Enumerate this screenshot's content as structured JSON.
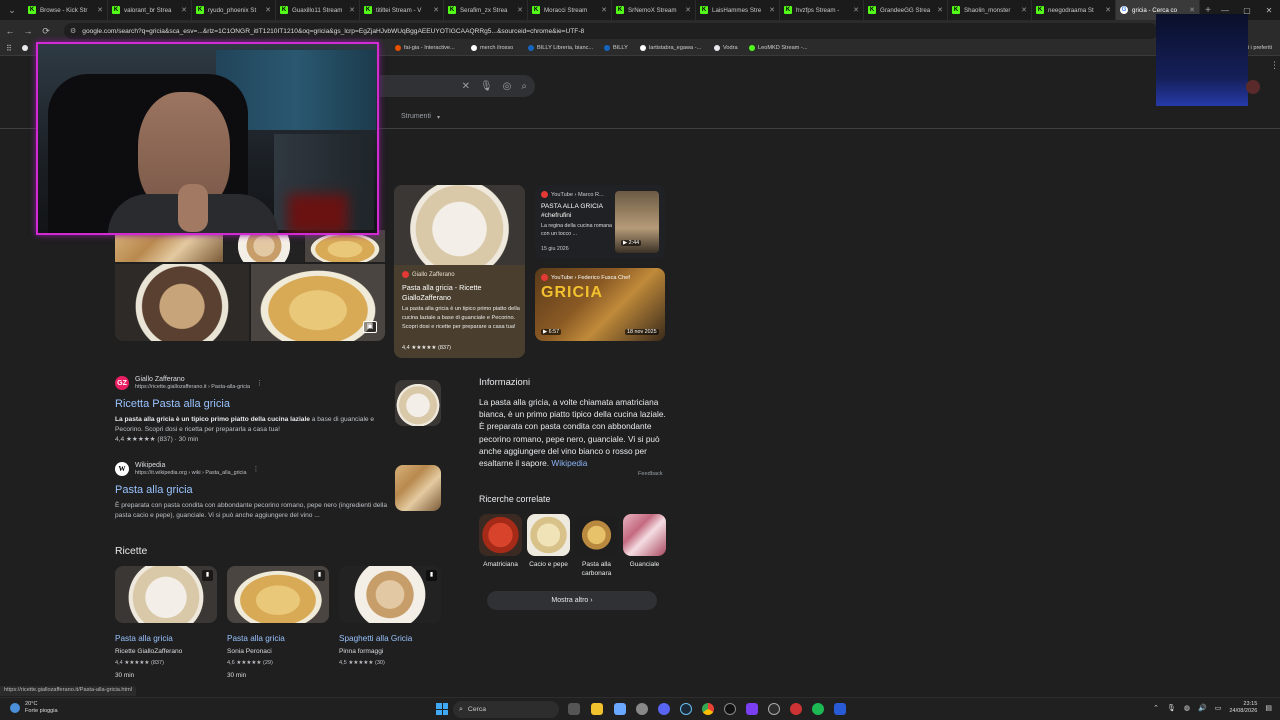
{
  "browser": {
    "tabs": [
      {
        "label": "Browse - Kick Str",
        "active": false
      },
      {
        "label": "valorant_br Strea",
        "active": false
      },
      {
        "label": "ryudo_phoenix St",
        "active": false
      },
      {
        "label": "Guaxillo11 Stream",
        "active": false
      },
      {
        "label": "titiltei Stream - V",
        "active": false
      },
      {
        "label": "Serafim_zx Strea",
        "active": false
      },
      {
        "label": "Moracci Stream",
        "active": false
      },
      {
        "label": "SrNemoX Stream",
        "active": false
      },
      {
        "label": "LaisHammes Stre",
        "active": false
      },
      {
        "label": "hvzfps Stream -",
        "active": false
      },
      {
        "label": "GrandeeGG Strea",
        "active": false
      },
      {
        "label": "Shaolin_monster",
        "active": false
      },
      {
        "label": "neegodraama St",
        "active": false
      },
      {
        "label": "gricia - Cerca co",
        "active": true
      }
    ],
    "url": "google.com/search?q=gricia&sca_esv=...&rlz=1C1ONGR_itIT1210IT1210&oq=gricia&gs_lcrp=EgZjaHJvbWUqBggAEEUYOTIGCAAQRRg5...&sourceid=chrome&ie=UTF-8",
    "bookmarks": [
      {
        "label": "",
        "color": "#e8eaed"
      },
      {
        "label": "fai-gia - Interactive...",
        "color": "#e65100"
      },
      {
        "label": "merch ilrosso",
        "color": "#ffffff"
      },
      {
        "label": "BILLY Libreria, bianc...",
        "color": "#1565c0"
      },
      {
        "label": "BILLY",
        "color": "#1565c0"
      },
      {
        "label": "lartistabra_egawa -...",
        "color": "#ffffff"
      },
      {
        "label": "Vodra",
        "color": "#e8eaed"
      },
      {
        "label": "LeoMKD Stream -...",
        "color": "#53fc18"
      }
    ],
    "other_bookmarks": "Tutti i preferiti"
  },
  "search": {
    "tools_label": "Strumenti"
  },
  "images": {
    "featured": {
      "source": "Giallo Zafferano",
      "title": "Pasta alla gricia - Ricette GialloZafferano",
      "description": "La pasta alla gricia è un tipico primo piatto della cucina laziale a base di guanciale e Pecorino. Scopri dosi e ricette per preparare a casa tua!",
      "rating": "4,4 ★★★★★ (837)"
    },
    "yt1": {
      "source": "YouTube › Marco R...",
      "title": "PASTA ALLA GRICIA #chefrufini",
      "description": "La regina della cucina romana con un tocco ...",
      "date": "15 giu 2026",
      "duration": "▶ 2:44"
    },
    "yt2": {
      "source": "YouTube › Federico Fusca Chef",
      "big_text": "GRICIA",
      "duration": "▶ 6:57",
      "date": "18 nov 2025"
    }
  },
  "results": [
    {
      "site": "Giallo Zafferano",
      "url": "https://ricette.giallozafferano.it › Pasta-alla-gricia",
      "title": "Ricetta Pasta alla gricia",
      "snippet_bold": "La pasta alla gricia è un tipico primo piatto della cucina laziale",
      "snippet": " a base di guanciale e Pecorino. Scopri dosi e ricetta per prepararla a casa tua!",
      "meta": "4,4 ★★★★★ (837) · 30 min"
    },
    {
      "site": "Wikipedia",
      "url": "https://it.wikipedia.org › wiki › Pasta_alla_gricia",
      "title": "Pasta alla gricia",
      "snippet": "È preparata con pasta condita con abbondante pecorino romano, pepe nero (ingredienti della pasta cacio e pepe), guanciale. Vi si può anche aggiungere del vino ..."
    }
  ],
  "knowledge_panel": {
    "title": "Informazioni",
    "text": "La pasta alla gricia, a volte chiamata amatriciana bianca, è un primo piatto tipico della cucina laziale. È preparata con pasta condita con abbondante pecorino romano, pepe nero, guanciale. Vi si può anche aggiungere del vino bianco o rosso per esaltarne il sapore.",
    "wiki_link": "Wikipedia",
    "feedback": "Feedback",
    "related_title": "Ricerche correlate",
    "related": [
      {
        "label": "Amatriciana"
      },
      {
        "label": "Cacio e pepe"
      },
      {
        "label": "Pasta alla carbonara"
      },
      {
        "label": "Guanciale"
      }
    ],
    "more_button": "Mostra altro"
  },
  "recipes": {
    "title": "Ricette",
    "items": [
      {
        "title": "Pasta alla gricia",
        "source": "Ricette GialloZafferano",
        "rating": "4,4 ★★★★★ (837)",
        "time": "30 min"
      },
      {
        "title": "Pasta alla gricia",
        "source": "Sonia Peronaci",
        "rating": "4,6 ★★★★★ (29)",
        "time": "30 min"
      },
      {
        "title": "Spaghetti alla Gricia",
        "source": "Pinna formaggi",
        "rating": "4,5 ★★★★★ (30)",
        "time": ""
      }
    ]
  },
  "status_url": "https://ricette.giallozafferano.it/Pasta-alla-gricia.html",
  "taskbar": {
    "temperature": "20°C",
    "weather": "Forte pioggia",
    "search_placeholder": "Cerca",
    "time": "23:15",
    "date": "24/08/2026"
  }
}
